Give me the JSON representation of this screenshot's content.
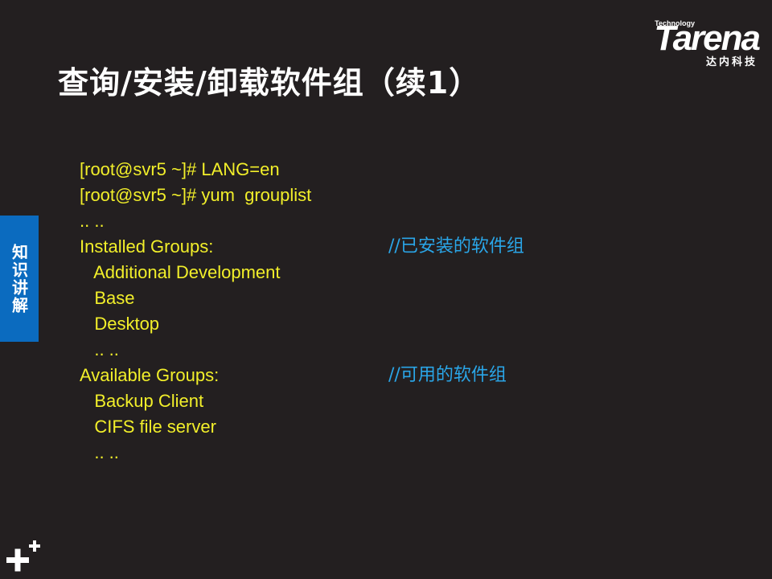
{
  "slide": {
    "title": "查询/安装/卸载软件组（续1）",
    "side_tab": "知识讲解"
  },
  "logo": {
    "technology": "Technology",
    "word": "Tarena",
    "sub": "达内科技"
  },
  "terminal": {
    "lines": [
      {
        "text": "[root@svr5 ~]# LANG=en",
        "comment": ""
      },
      {
        "text": "[root@svr5 ~]# yum  grouplist",
        "comment": ""
      },
      {
        "text": ".. ..",
        "comment": ""
      },
      {
        "text": "Installed Groups:",
        "comment": "//已安装的软件组"
      },
      {
        "text": "   Additional Development",
        "comment": ""
      },
      {
        "text": "   Base",
        "comment": ""
      },
      {
        "text": "   Desktop",
        "comment": ""
      },
      {
        "text": "   .. ..",
        "comment": ""
      },
      {
        "text": "Available Groups:",
        "comment": "//可用的软件组"
      },
      {
        "text": "   Backup Client",
        "comment": ""
      },
      {
        "text": "   CIFS file server",
        "comment": ""
      },
      {
        "text": "   .. ..",
        "comment": ""
      }
    ]
  },
  "colors": {
    "background": "#231f20",
    "command_text": "#f2ef2a",
    "comment_text": "#2aa6e8",
    "side_tab": "#0b6bbf",
    "title": "#ffffff"
  },
  "icons": {
    "corner": "plus-plus-icon"
  }
}
